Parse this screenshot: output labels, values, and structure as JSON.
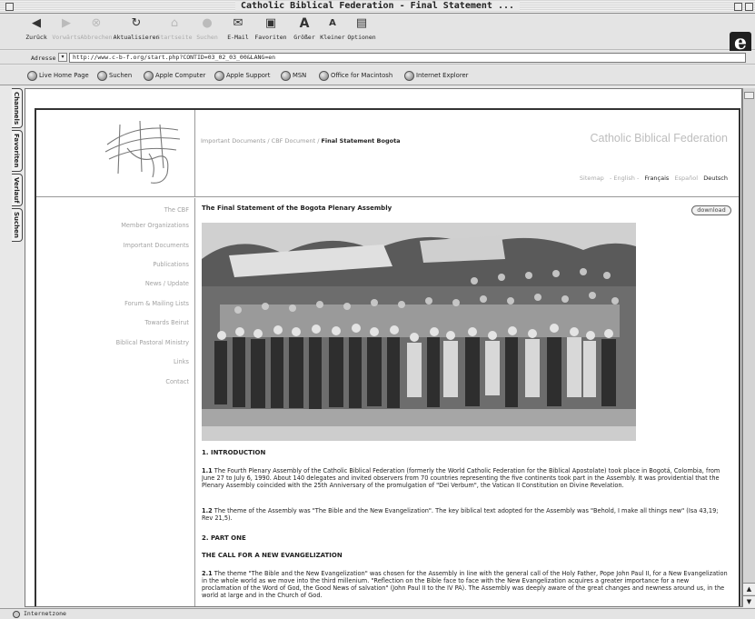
{
  "window": {
    "title": "Catholic Biblical Federation - Final Statement ..."
  },
  "toolbar": {
    "buttons": [
      {
        "label": "Zurück",
        "icon": "back-arrow-icon",
        "enabled": true
      },
      {
        "label": "Vorwärts",
        "icon": "forward-arrow-icon",
        "enabled": false
      },
      {
        "label": "Abbrechen",
        "icon": "stop-icon",
        "enabled": false
      },
      {
        "label": "Aktualisieren",
        "icon": "refresh-icon",
        "enabled": true
      },
      {
        "label": "Startseite",
        "icon": "home-icon",
        "enabled": false
      },
      {
        "label": "Suchen",
        "icon": "search-icon",
        "enabled": false
      },
      {
        "label": "E-Mail",
        "icon": "mail-icon",
        "enabled": true
      },
      {
        "label": "Favoriten",
        "icon": "favorites-icon",
        "enabled": true
      },
      {
        "label": "Größer",
        "icon": "text-larger-icon",
        "enabled": true
      },
      {
        "label": "Kleiner",
        "icon": "text-smaller-icon",
        "enabled": true
      },
      {
        "label": "Optionen",
        "icon": "options-icon",
        "enabled": true
      }
    ]
  },
  "address": {
    "label": "Adresse",
    "url": "http://www.c-b-f.org/start.php?CONTID=03_02_03_00&LANG=en"
  },
  "favorites": [
    "Live Home Page",
    "Suchen",
    "Apple Computer",
    "Apple Support",
    "MSN",
    "Office for Macintosh",
    "Internet Explorer"
  ],
  "sidetabs": [
    "Channels",
    "Favoriten",
    "Verlauf",
    "Suchen"
  ],
  "site": {
    "breadcrumb_prefix": "Important Documents / CBF Document / ",
    "breadcrumb_current": "Final Statement Bogota",
    "title": "Catholic Biblical Federation",
    "languages": [
      {
        "label": "Sitemap",
        "selected": false
      },
      {
        "label": "- English -",
        "selected": false
      },
      {
        "label": "Français",
        "selected": true
      },
      {
        "label": "Español",
        "selected": false
      },
      {
        "label": "Deutsch",
        "selected": true
      }
    ],
    "nav": [
      "The CBF",
      "Member Organizations",
      "Important Documents",
      "Publications",
      "News / Update",
      "Forum & Mailing Lists",
      "Towards Beirut",
      "Biblical Pastoral Ministry",
      "Links",
      "Contact"
    ]
  },
  "document": {
    "title": "The Final Statement of the Bogota Plenary Assembly",
    "download_label": "download",
    "intro_heading": "1. INTRODUCTION",
    "p11_num": "1.1",
    "p11": "The Fourth Plenary Assembly of the Catholic Biblical Federation (formerly the World Catholic Federation for the Biblical Apostolate) took place in Bogotá, Colombia, from June 27 to July 6, 1990. About 140 delegates and invited observers from 70 countries representing the five continents took part in the Assembly. It was providential that the Plenary Assembly coincided with the 25th Anniversary of the promulgation of \"Dei Verbum\", the Vatican II Constitution on Divine Revelation.",
    "p12_num": "1.2",
    "p12": "The theme of the Assembly was \"The Bible and the New Evangelization\". The key biblical text adopted for the Assembly was \"Behold, I make all things new\" (Isa 43,19; Rev 21,5).",
    "part_one": "2. PART ONE",
    "call_heading": "THE CALL FOR A NEW EVANGELIZATION",
    "p21_num": "2.1",
    "p21": "The theme \"The Bible and the New Evangelization\" was chosen for the Assembly in line with the general call of the Holy Father, Pope John Paul II, for a New Evangelization in the whole world as we move into the third millenium. \"Reflection on the Bible face to face with the New Evangelization acquires a greater importance for a new proclamation of the Word of God, the Good News of salvation\" (John Paul II to the IV PA). The Assembly was deeply aware of the great changes and newness around us, in the world at large and in the Church of God."
  },
  "status": {
    "zone": "Internetzone"
  }
}
